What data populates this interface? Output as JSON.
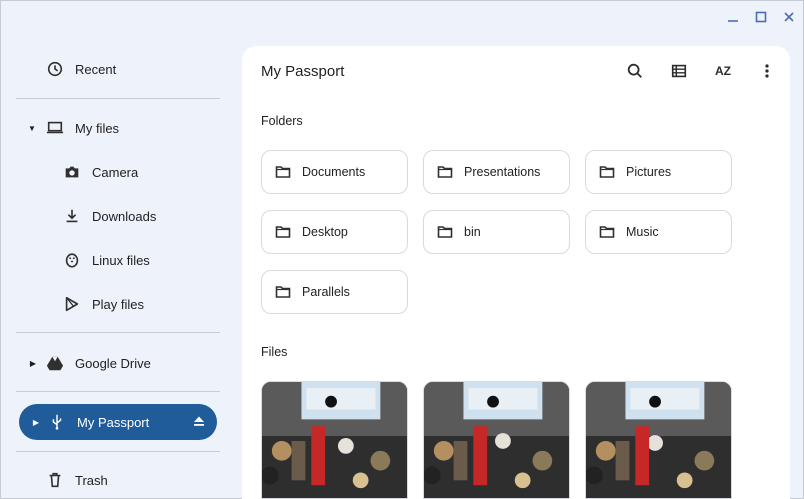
{
  "sidebar": {
    "recent": "Recent",
    "my_files": "My files",
    "camera": "Camera",
    "downloads": "Downloads",
    "linux_files": "Linux files",
    "play_files": "Play files",
    "google_drive": "Google Drive",
    "my_passport": "My Passport",
    "trash": "Trash"
  },
  "main": {
    "title": "My Passport",
    "folders_label": "Folders",
    "files_label": "Files",
    "folders": [
      "Documents",
      "Presentations",
      "Pictures",
      "Desktop",
      "bin",
      "Music",
      "Parallels"
    ]
  },
  "toolbar": {
    "sort_label": "AZ"
  },
  "icons": {
    "recent": "clock-icon",
    "my_files": "laptop-icon",
    "camera": "camera-icon",
    "downloads": "download-icon",
    "linux": "penguin-icon",
    "play": "play-store-icon",
    "drive": "google-drive-icon",
    "usb": "usb-icon",
    "trash": "trash-icon"
  },
  "colors": {
    "selected_bg": "#1f5c99",
    "window_bg": "#eef2fa",
    "panel_bg": "#ffffff"
  }
}
